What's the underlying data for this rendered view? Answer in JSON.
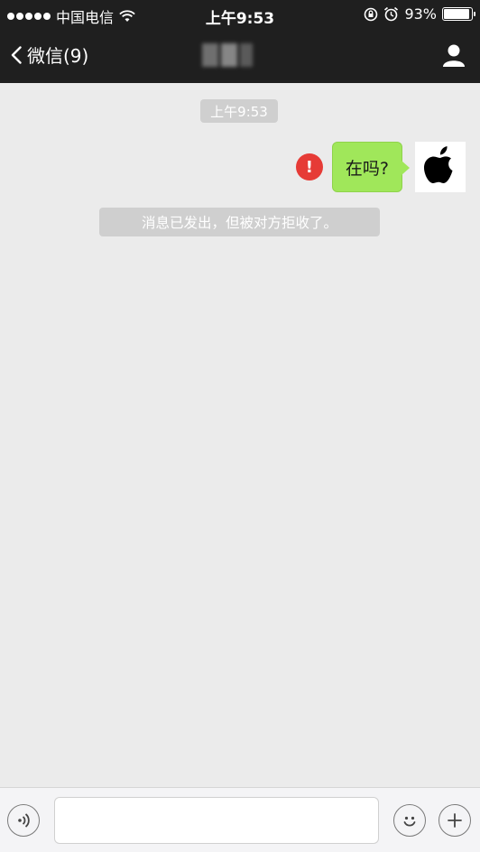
{
  "status_bar": {
    "carrier": "中国电信",
    "time": "上午9:53",
    "battery": "93%",
    "battery_level": 0.93,
    "icons": [
      "signal-dots",
      "wifi-icon",
      "rotation-lock-icon",
      "alarm-icon",
      "battery-icon"
    ]
  },
  "nav": {
    "back_label": "微信(9)",
    "title_obscured": true,
    "right_icon": "person-icon"
  },
  "chat": {
    "timestamp": "上午9:53",
    "messages": [
      {
        "side": "right",
        "text": "在吗?",
        "status": "error",
        "avatar": "apple-logo"
      }
    ],
    "system_notice": "消息已发出，但被对方拒收了。"
  },
  "input_bar": {
    "value": "",
    "icons": [
      "voice-icon",
      "emoji-icon",
      "plus-icon"
    ]
  },
  "colors": {
    "nav_bg": "#1f1f1f",
    "chat_bg": "#ebebeb",
    "bubble_green": "#a0e75a",
    "error_red": "#e63b36",
    "chip_bg": "#cfcfcf"
  }
}
